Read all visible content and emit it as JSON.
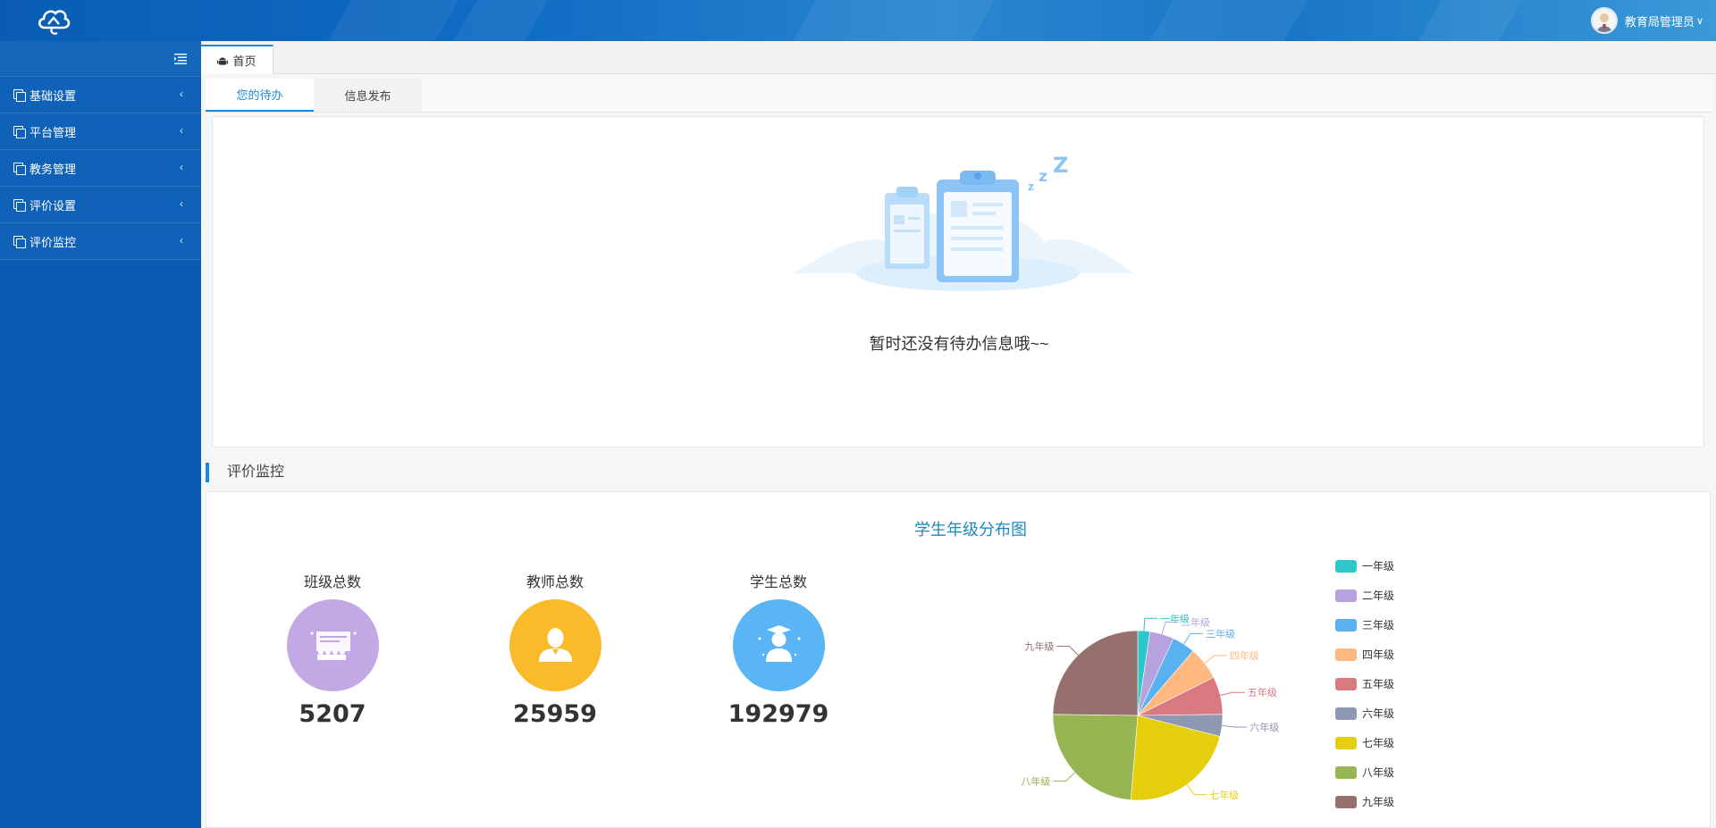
{
  "header": {
    "user_name": "教育局管理员",
    "caret": "∨"
  },
  "sidebar": {
    "items": [
      {
        "label": "基础设置"
      },
      {
        "label": "平台管理"
      },
      {
        "label": "教务管理"
      },
      {
        "label": "评价设置"
      },
      {
        "label": "评价监控"
      }
    ]
  },
  "tabs": {
    "home_label": "首页"
  },
  "subtabs": [
    {
      "label": "您的待办",
      "active": true
    },
    {
      "label": "信息发布",
      "active": false
    }
  ],
  "todo": {
    "empty_message": "暂时还没有待办信息哦~~"
  },
  "section": {
    "title": "评价监控"
  },
  "stats": [
    {
      "label": "班级总数",
      "value": "5207",
      "color": "#c3a8e6",
      "icon": "classroom-icon"
    },
    {
      "label": "教师总数",
      "value": "25959",
      "color": "#f9bb2a",
      "icon": "teacher-icon"
    },
    {
      "label": "学生总数",
      "value": "192979",
      "color": "#5ab5f5",
      "icon": "graduate-icon"
    }
  ],
  "chart_data": {
    "type": "pie",
    "title": "学生年级分布图",
    "categories": [
      "一年级",
      "二年级",
      "三年级",
      "四年级",
      "五年级",
      "六年级",
      "七年级",
      "八年级",
      "九年级"
    ],
    "values": [
      2.3,
      4.6,
      4.4,
      6.3,
      7.2,
      4.2,
      22.3,
      23.9,
      24.8
    ],
    "colors": [
      "#2ec7c9",
      "#b6a2de",
      "#5ab1ef",
      "#ffb980",
      "#d87a80",
      "#8d98b3",
      "#e5cf0d",
      "#97b552",
      "#95706d"
    ],
    "legend_position": "right"
  }
}
